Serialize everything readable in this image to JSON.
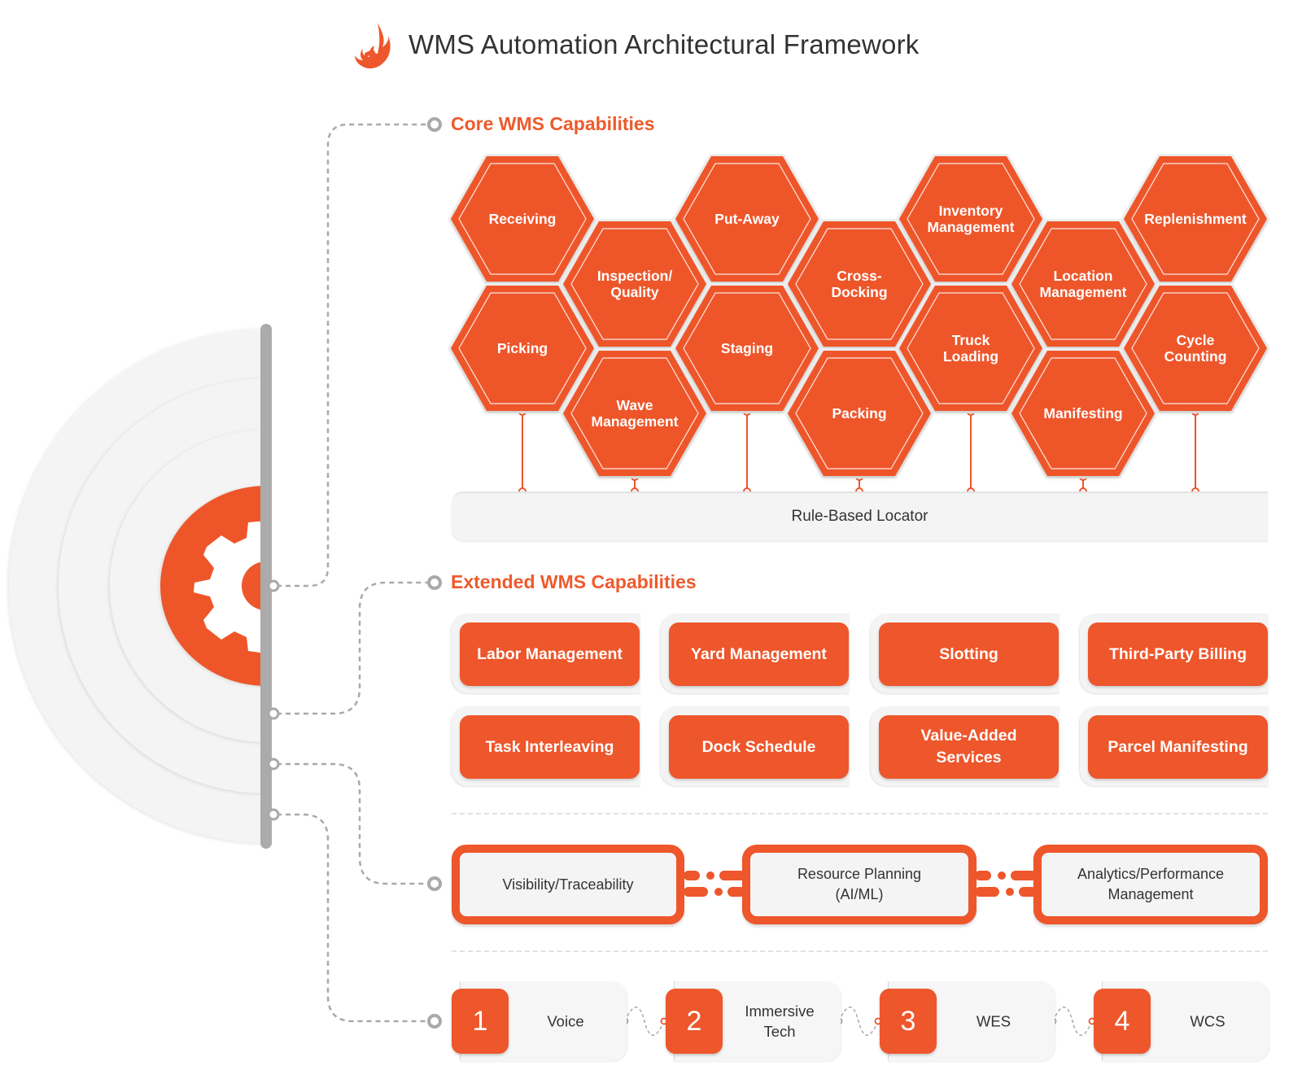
{
  "header": {
    "title": "WMS Automation Architectural Framework",
    "logo_icon": "flame-icon"
  },
  "colors": {
    "accent": "#ee562b",
    "section_heading": "#ee5a2c",
    "card_background": "#f4f4f4",
    "connector_gray": "#a9a9a9",
    "text_dark": "#333333"
  },
  "hub": {
    "icon": "gear-icon"
  },
  "core": {
    "heading": "Core WMS Capabilities",
    "hexagons": [
      {
        "label": "Receiving"
      },
      {
        "label": "Picking"
      },
      {
        "label": "Inspection/ Quality"
      },
      {
        "label": "Wave Management"
      },
      {
        "label": "Put-Away"
      },
      {
        "label": "Staging"
      },
      {
        "label": "Cross- Docking"
      },
      {
        "label": "Packing"
      },
      {
        "label": "Inventory Management"
      },
      {
        "label": "Truck Loading"
      },
      {
        "label": "Location Management"
      },
      {
        "label": "Manifesting"
      },
      {
        "label": "Replenishment"
      },
      {
        "label": "Cycle Counting"
      }
    ],
    "foundation": "Rule-Based Locator"
  },
  "extended": {
    "heading": "Extended WMS Capabilities",
    "rows": [
      [
        "Labor Management",
        "Yard Management",
        "Slotting",
        "Third-Party Billing"
      ],
      [
        "Task Interleaving",
        "Dock Schedule",
        "Value-Added Services",
        "Parcel Manifesting"
      ]
    ]
  },
  "intelligence": {
    "items": [
      "Visibility/Traceability",
      "Resource Planning (AI/ML)",
      "Analytics/Performance Management"
    ]
  },
  "technologies": {
    "items": [
      {
        "number": "1",
        "label": "Voice"
      },
      {
        "number": "2",
        "label": "Immersive Tech"
      },
      {
        "number": "3",
        "label": "WES"
      },
      {
        "number": "4",
        "label": "WCS"
      }
    ]
  }
}
